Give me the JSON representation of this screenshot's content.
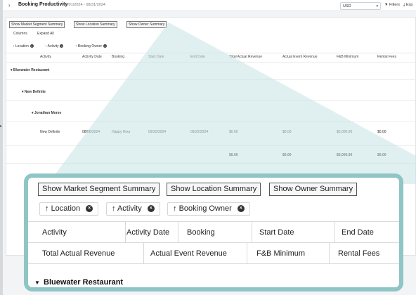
{
  "topbar": {
    "title": "Booking Productivity",
    "date_range": "08/01/2024 - 08/31/2024",
    "currency": "USD",
    "filters_label": "Filters",
    "export_label": "Exp"
  },
  "summary_buttons": [
    "Show Market Segment Summary",
    "Show Location Summary",
    "Show Owner Summary"
  ],
  "toolbar": {
    "columns_label": "Columns",
    "expand_all_label": "Expand All"
  },
  "grouping_chips": [
    "Location",
    "Activity",
    "Booking Owner"
  ],
  "table": {
    "headers": [
      "Activity",
      "Activity Date",
      "Booking",
      "Start Date",
      "End Date",
      "Total Actual Revenue",
      "Actual Event Revenue",
      "F&B Minimum",
      "Rental Fees"
    ],
    "groups": {
      "location": "Bluewater Restaurant",
      "activity": "New Definite",
      "owner": "Jonathan Morse"
    },
    "row": [
      "New Definite",
      "08/06/2024",
      "Happy Hour",
      "09/22/2024",
      "09/22/2024",
      "$0.00",
      "$0.00",
      "$5,000.00",
      "$0.00"
    ],
    "totals": [
      "$0.00",
      "$0.00",
      "$5,000.00",
      "$0.00"
    ]
  },
  "colors": {
    "zoom_border": "#8fc6c5",
    "zoom_wedge": "#c7e4e3"
  }
}
